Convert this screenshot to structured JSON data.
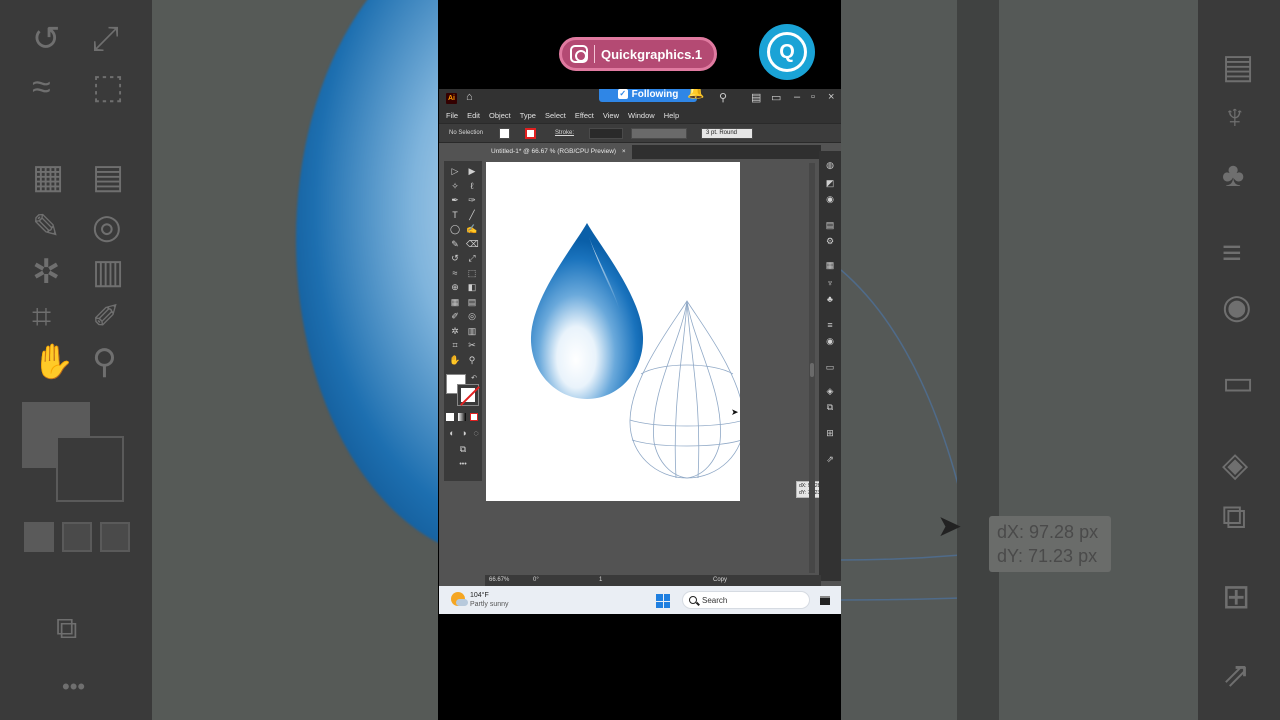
{
  "overlay": {
    "instagram_handle": "Quickgraphics.1",
    "following_label": "Following",
    "brand_logo_letter": "Q"
  },
  "app": {
    "title": "Adobe Illustrator",
    "badge": "Ai",
    "menu": [
      "File",
      "Edit",
      "Object",
      "Type",
      "Select",
      "Effect",
      "View",
      "Window",
      "Help"
    ],
    "control_bar": {
      "selection": "No Selection",
      "stroke_label": "Stroke:",
      "brush": "3 pt. Round"
    },
    "document_tab": "Untitled-1* @ 66.67 % (RGB/CPU Preview)",
    "close_glyph": "×",
    "toolbar_more": "•••",
    "move_readout": {
      "dx": "dX: 97.28 px",
      "dy": "dY: 71.23 px"
    },
    "status": {
      "zoom": "66.67%",
      "rotation": "0°",
      "artboard": "1",
      "mode": "Copy"
    }
  },
  "zoomed_readout": {
    "dx": "dX: 97.28 px",
    "dy": "dY: 71.23 px"
  },
  "taskbar": {
    "temperature": "104°F",
    "condition": "Partly sunny",
    "search_placeholder": "Search"
  },
  "colors": {
    "drop_dark": "#0a5fa8",
    "drop_light": "#e9f3fb",
    "instagram_pink": "#b44a73",
    "brand_blue": "#1aa3d6",
    "following_blue": "#2f86e6"
  }
}
